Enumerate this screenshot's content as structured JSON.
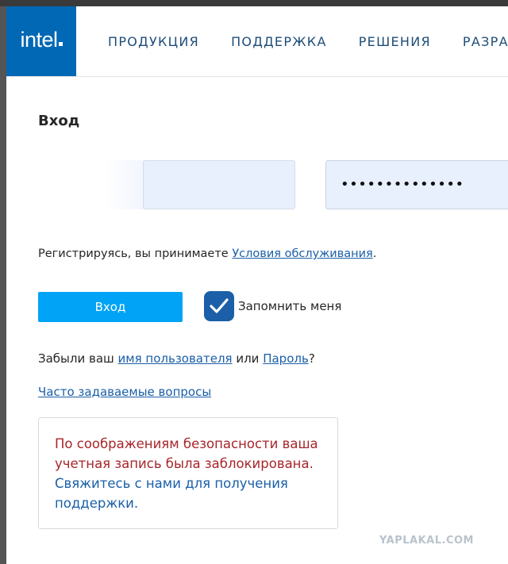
{
  "header": {
    "logo": "intel",
    "nav": [
      "ПРОДУКЦИЯ",
      "ПОДДЕРЖКА",
      "РЕШЕНИЯ",
      "РАЗРА"
    ]
  },
  "login": {
    "title": "Вход",
    "password_value": "••••••••••••••",
    "terms_prefix": "Регистрируясь, вы принимаете ",
    "terms_link": "Условия обслуживания",
    "terms_suffix": ".",
    "login_button": "Вход",
    "remember_label": "Запомнить меня",
    "remember_checked": true,
    "forgot_prefix": "Забыли ваш ",
    "forgot_username_link": "имя пользователя",
    "forgot_middle": " или ",
    "forgot_password_link": "Пароль",
    "forgot_suffix": "?",
    "faq_link": "Часто задаваемые вопросы"
  },
  "alert": {
    "text": "По соображениям безопасности ваша учетная запись была заблокирована. ",
    "contact_link": "Свяжитесь с нами для получения поддержки."
  },
  "watermark": "YAPLAKAL.COM",
  "colors": {
    "brand": "#0068b5",
    "button": "#00a3f6",
    "link": "#1a5fa8",
    "alert_text": "#a7262a",
    "field_bg": "#e8f0fe"
  }
}
